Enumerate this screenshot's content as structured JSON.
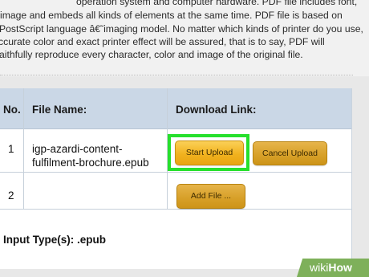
{
  "description": {
    "lines": [
      "operation system and computer hardware. PDF file includes font,",
      "image and embeds all kinds of elements at the same time. PDF file is based on",
      "PostScript language â€˜imaging model. No matter which kinds of printer do you use,",
      "ccurate color and exact printer effect will be assured, that is to say, PDF will",
      "aithfully reproduce every character, color and image of the original file."
    ]
  },
  "table": {
    "headers": {
      "no": "No.",
      "file_name": "File Name:",
      "download_link": "Download Link:"
    },
    "rows": [
      {
        "no": "1",
        "file_name_line1": "igp-azardi-content-",
        "file_name_line2": "fulfilment-brochure.epub"
      },
      {
        "no": "2",
        "file_name_line1": "",
        "file_name_line2": ""
      }
    ],
    "footer": "Input Type(s): .epub"
  },
  "buttons": {
    "start_upload": "Start Upload",
    "cancel_upload": "Cancel Upload",
    "add_file": "Add File ..."
  },
  "watermark": {
    "wiki": "wiki",
    "how": "How"
  },
  "colors": {
    "header_bg": "#cad7e6",
    "button_gold": "#f1b21f",
    "highlight_green": "#27e02c",
    "wikihow_green": "#7eb05a"
  }
}
